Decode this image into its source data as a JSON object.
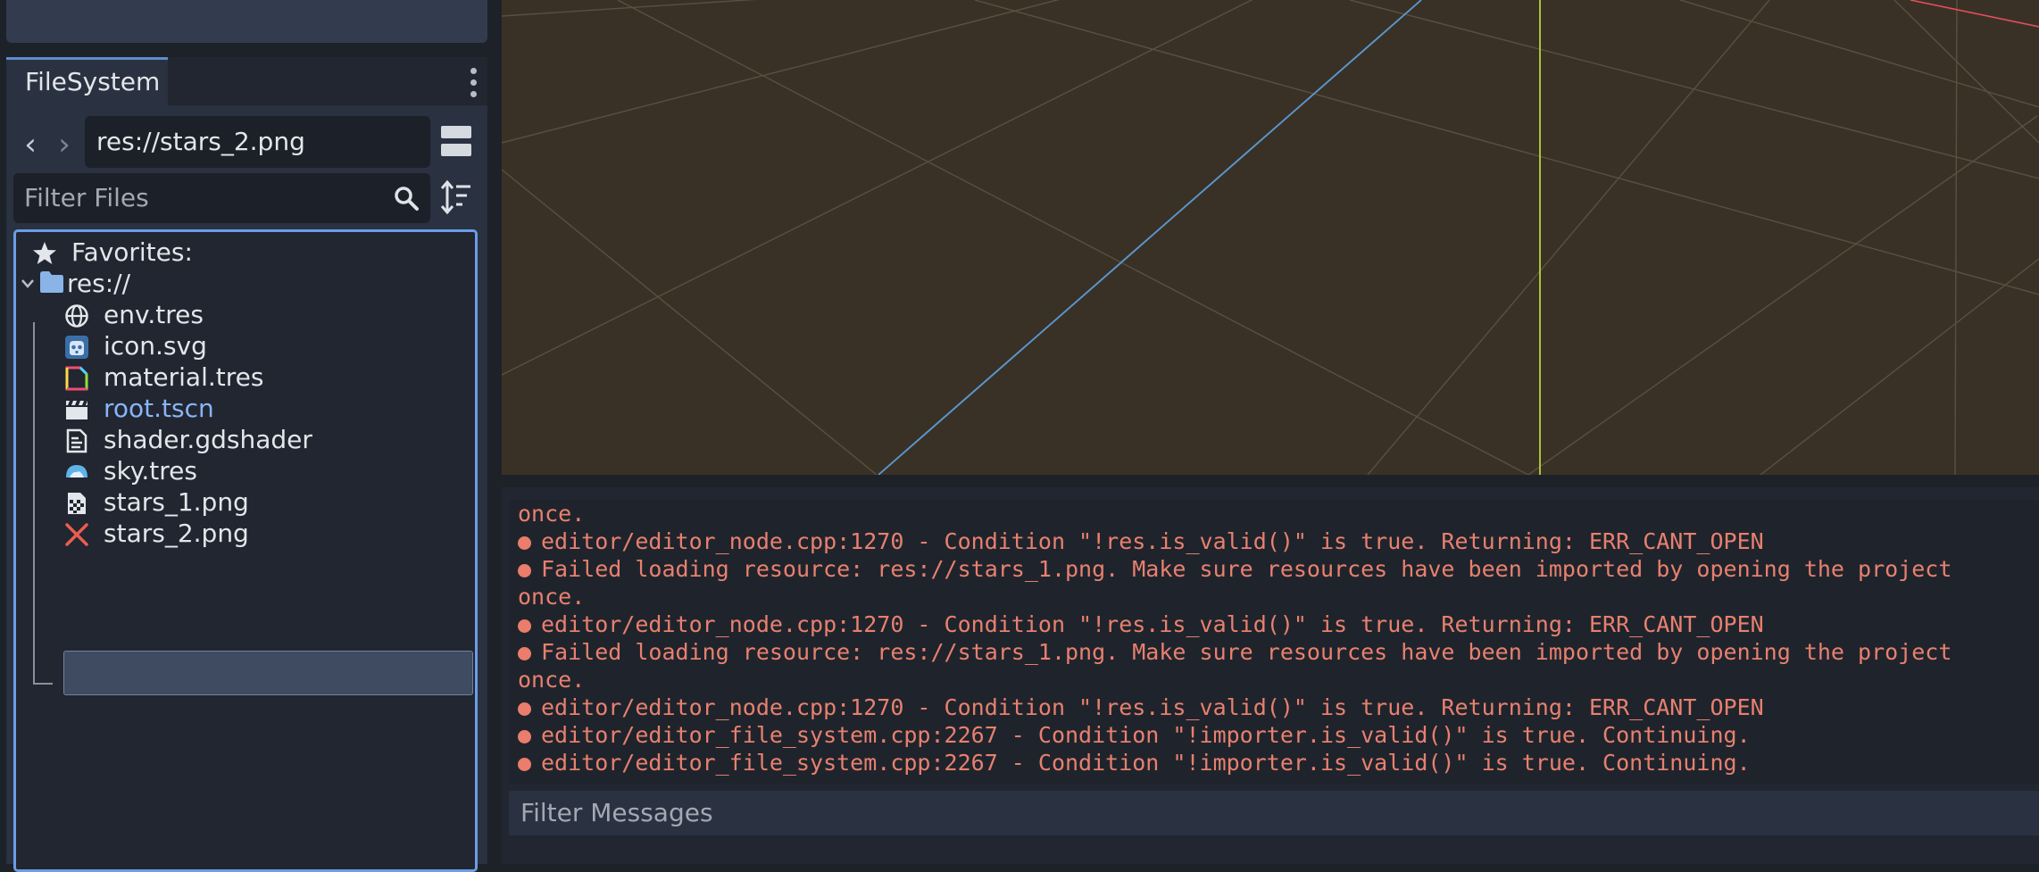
{
  "filesystem": {
    "tab_label": "FileSystem",
    "path_value": "res://stars_2.png",
    "filter_placeholder": "Filter Files",
    "favorites_label": "Favorites:",
    "root_label": "res://",
    "files": [
      {
        "name": "env.tres",
        "icon": "globe-icon"
      },
      {
        "name": "icon.svg",
        "icon": "godot-icon"
      },
      {
        "name": "material.tres",
        "icon": "material-icon"
      },
      {
        "name": "root.tscn",
        "icon": "clapperboard-icon"
      },
      {
        "name": "shader.gdshader",
        "icon": "shader-icon"
      },
      {
        "name": "sky.tres",
        "icon": "sky-icon"
      },
      {
        "name": "stars_1.png",
        "icon": "image-icon"
      },
      {
        "name": "stars_2.png",
        "icon": "error-x-icon"
      }
    ],
    "selected_file": "stars_2.png",
    "colors": {
      "selected_label": "#e3e6ea",
      "scene_link": "#8ab4f8",
      "error_red": "#ea5d4f",
      "accent": "#6c9de6"
    }
  },
  "output": {
    "lines": [
      {
        "bullet": false,
        "text": "once."
      },
      {
        "bullet": true,
        "text": "editor/editor_node.cpp:1270 - Condition \"!res.is_valid()\" is true. Returning: ERR_CANT_OPEN"
      },
      {
        "bullet": true,
        "text": "Failed loading resource: res://stars_1.png. Make sure resources have been imported by opening the project"
      },
      {
        "bullet": false,
        "text": "once."
      },
      {
        "bullet": true,
        "text": "editor/editor_node.cpp:1270 - Condition \"!res.is_valid()\" is true. Returning: ERR_CANT_OPEN"
      },
      {
        "bullet": true,
        "text": "Failed loading resource: res://stars_1.png. Make sure resources have been imported by opening the project"
      },
      {
        "bullet": false,
        "text": "once."
      },
      {
        "bullet": true,
        "text": "editor/editor_node.cpp:1270 - Condition \"!res.is_valid()\" is true. Returning: ERR_CANT_OPEN"
      },
      {
        "bullet": true,
        "text": "editor/editor_file_system.cpp:2267 - Condition \"!importer.is_valid()\" is true. Continuing."
      },
      {
        "bullet": true,
        "text": "editor/editor_file_system.cpp:2267 - Condition \"!importer.is_valid()\" is true. Continuing."
      }
    ],
    "filter_placeholder": "Filter Messages",
    "error_color": "#e8806f"
  },
  "viewport": {
    "background": "#3a3126",
    "x_axis_color": "#e0505a",
    "y_axis_color": "#b6d33a",
    "z_axis_color": "#5a9ad6"
  }
}
